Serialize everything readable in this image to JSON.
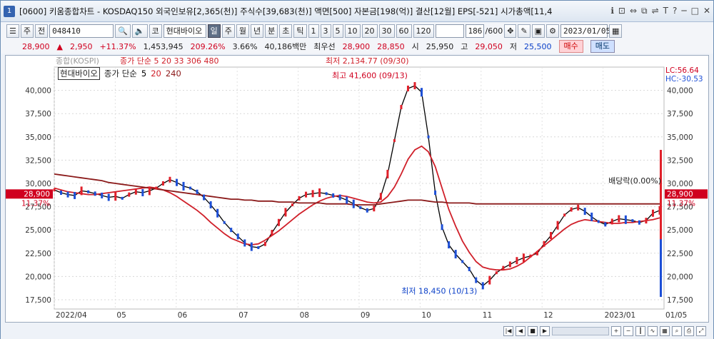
{
  "window": {
    "number": "1",
    "title": "[0600] 키움종합차트 - KOSDAQ150 외국인보유[2,365(천)] 주식수[39,683(천)] 액면[500] 자본금[198(억)] 결산[12월] EPS[-521] 시가총액[11,4"
  },
  "title_controls": [
    "ℹ",
    "⊡",
    "⇔",
    "⧉",
    "⇌",
    "T",
    "?",
    "─",
    "□",
    "✕"
  ],
  "toolbar": {
    "type": "주",
    "period_toggle": "전",
    "code": "048410",
    "name_prefix": "코",
    "stock_name": "현대바이오",
    "intervals": [
      "일",
      "주",
      "월",
      "년",
      "분",
      "초",
      "틱"
    ],
    "active_interval": "일",
    "minutes": [
      "1",
      "3",
      "5",
      "10",
      "20",
      "30",
      "60",
      "120"
    ],
    "count": "186",
    "count_total": "/600",
    "date": "2023/01/05"
  },
  "quote": {
    "price": "28,900",
    "arrow": "▲",
    "change": "2,950",
    "pct": "+11.37%",
    "volume": "1,453,945",
    "vol_ratio": "209.26%",
    "turnover": "3.66%",
    "amount": "40,186백만",
    "best_label": "최우선",
    "best_ask": "28,900",
    "best_bid": "28,850",
    "open_label": "시",
    "open": "25,950",
    "high_label": "고",
    "high": "29,050",
    "low_label": "저",
    "low": "25,500",
    "buy": "매수",
    "sell": "매도"
  },
  "chart_data": {
    "type": "line",
    "title": "현대바이오",
    "legend": [
      "종가 단순",
      "5",
      "20",
      "240"
    ],
    "x_labels": [
      "2022/04",
      "05",
      "06",
      "07",
      "08",
      "09",
      "10",
      "11",
      "12",
      "2023/01",
      "01/05"
    ],
    "y_ticks": [
      40000,
      37500,
      35000,
      32500,
      30000,
      27500,
      25000,
      22500,
      20000,
      17500
    ],
    "y_tick_labels": [
      "40,000",
      "37,500",
      "35,000",
      "32,500",
      "30,000",
      "27,500",
      "25,000",
      "22,500",
      "20,000",
      "17,500"
    ],
    "ylim": [
      16500,
      42500
    ],
    "last_price": 28900,
    "last_price_label": "28,900",
    "last_pct": "11.37%",
    "lc": "LC:56.64",
    "hc": "HC:-30.53",
    "high_note": "최고 41,600 (09/13)",
    "low_note": "최저 18,450 (10/13)",
    "dividend_note": "배당락(0.00%)",
    "top_cut_left": "종합(KOSPI)",
    "top_cut_mid": "종가 단순 5 20 33 306 480",
    "top_cut_right": "최저 2,134.77 (09/30)",
    "series": [
      {
        "name": "5",
        "color": "#000000",
        "values": [
          29300,
          29000,
          28800,
          28700,
          29200,
          29100,
          28900,
          28700,
          28500,
          28600,
          28400,
          28800,
          29100,
          29000,
          29200,
          29500,
          30000,
          30400,
          30100,
          29700,
          29500,
          29100,
          28500,
          27700,
          26800,
          25800,
          25000,
          24300,
          23600,
          23200,
          23100,
          23500,
          24700,
          25800,
          26900,
          27700,
          28400,
          28800,
          28900,
          29000,
          28900,
          28700,
          28500,
          28200,
          27800,
          27400,
          27100,
          27300,
          28600,
          31000,
          34600,
          38200,
          40200,
          40500,
          39800,
          35000,
          29000,
          25300,
          23400,
          22400,
          21600,
          20800,
          19600,
          19000,
          19600,
          20400,
          20900,
          21300,
          21700,
          22000,
          22200,
          22500,
          23500,
          24400,
          25500,
          26600,
          27200,
          27400,
          27000,
          26400,
          25900,
          25600,
          25900,
          26200,
          26100,
          26000,
          25800,
          26000,
          26800,
          27100
        ]
      },
      {
        "name": "20",
        "color": "#d0202a",
        "values": [
          29500,
          29300,
          29100,
          29000,
          28900,
          28800,
          28800,
          28900,
          29000,
          29100,
          29200,
          29300,
          29400,
          29500,
          29600,
          29500,
          29300,
          29000,
          28600,
          28100,
          27600,
          27100,
          26500,
          25800,
          25200,
          24600,
          24100,
          23800,
          23500,
          23400,
          23500,
          23900,
          24400,
          24900,
          25500,
          26100,
          26700,
          27200,
          27700,
          28100,
          28400,
          28600,
          28700,
          28600,
          28400,
          28200,
          28000,
          27900,
          28000,
          28600,
          29600,
          31000,
          32600,
          33600,
          34000,
          33400,
          31800,
          29500,
          27200,
          25400,
          23800,
          22600,
          21600,
          21000,
          20800,
          20700,
          20700,
          20800,
          21100,
          21500,
          22100,
          22700,
          23300,
          23900,
          24500,
          25100,
          25600,
          25900,
          26100,
          26000,
          25900,
          25800,
          25700,
          25700,
          25800,
          25800,
          25900,
          26000,
          26100,
          26300
        ]
      },
      {
        "name": "240",
        "color": "#8b1a1a",
        "values": [
          31000,
          30900,
          30800,
          30700,
          30600,
          30500,
          30400,
          30300,
          30100,
          30000,
          29900,
          29800,
          29700,
          29600,
          29500,
          29400,
          29300,
          29200,
          29100,
          29000,
          28900,
          28800,
          28700,
          28600,
          28500,
          28400,
          28300,
          28300,
          28200,
          28200,
          28100,
          28100,
          28100,
          28000,
          28000,
          28000,
          27900,
          27900,
          27900,
          27900,
          27800,
          27800,
          27800,
          27800,
          27700,
          27700,
          27700,
          27700,
          27800,
          27900,
          28000,
          28100,
          28200,
          28200,
          28200,
          28100,
          28000,
          28000,
          27900,
          27900,
          27900,
          27900,
          27800,
          27800,
          27800,
          27800,
          27800,
          27800,
          27800,
          27800,
          27800,
          27800,
          27800,
          27800,
          27800,
          27800,
          27800,
          27800,
          27800,
          27800,
          27800,
          27800,
          27800,
          27800,
          27800,
          27800,
          27800,
          27800,
          27800,
          27800
        ]
      }
    ]
  }
}
